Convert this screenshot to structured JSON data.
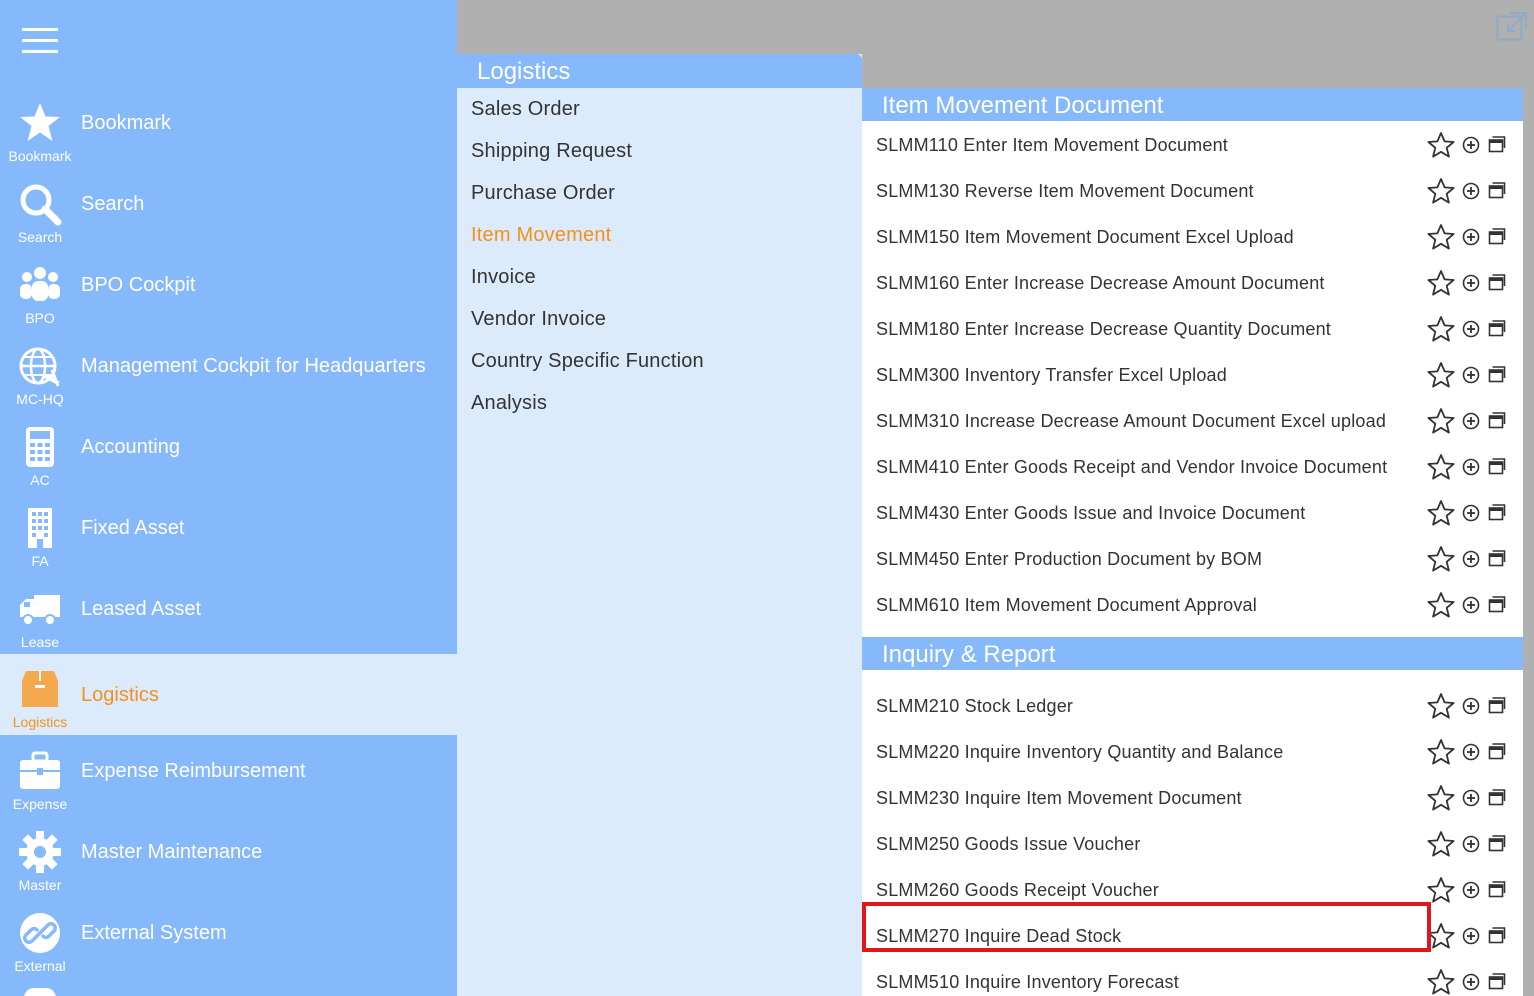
{
  "sidebar": {
    "items": [
      {
        "label": "Bookmark",
        "short": "Bookmark",
        "icon": "star-icon"
      },
      {
        "label": "Search",
        "short": "Search",
        "icon": "search-icon"
      },
      {
        "label": "BPO Cockpit",
        "short": "BPO",
        "icon": "users-icon"
      },
      {
        "label": "Management Cockpit for Headquarters",
        "short": "MC-HQ",
        "icon": "globe-plane-icon"
      },
      {
        "label": "Accounting",
        "short": "AC",
        "icon": "calculator-icon"
      },
      {
        "label": "Fixed Asset",
        "short": "FA",
        "icon": "building-icon"
      },
      {
        "label": "Leased Asset",
        "short": "Lease",
        "icon": "truck-icon"
      },
      {
        "label": "Logistics",
        "short": "Logistics",
        "icon": "box-icon",
        "active": true
      },
      {
        "label": "Expense Reimbursement",
        "short": "Expense",
        "icon": "briefcase-icon"
      },
      {
        "label": "Master Maintenance",
        "short": "Master",
        "icon": "gear-icon"
      },
      {
        "label": "External System",
        "short": "External",
        "icon": "link-icon"
      }
    ]
  },
  "mid": {
    "title": "Logistics",
    "items": [
      {
        "label": "Sales Order"
      },
      {
        "label": "Shipping Request"
      },
      {
        "label": "Purchase Order"
      },
      {
        "label": "Item Movement",
        "active": true
      },
      {
        "label": "Invoice"
      },
      {
        "label": "Vendor Invoice"
      },
      {
        "label": "Country Specific Function"
      },
      {
        "label": "Analysis"
      }
    ]
  },
  "right": {
    "sections": [
      {
        "title": "Item Movement Document",
        "rows": [
          "SLMM110 Enter Item Movement Document",
          "SLMM130 Reverse Item Movement Document",
          "SLMM150 Item Movement Document Excel Upload",
          "SLMM160 Enter Increase Decrease Amount Document",
          "SLMM180 Enter Increase Decrease Quantity Document",
          "SLMM300 Inventory Transfer Excel Upload",
          "SLMM310 Increase Decrease Amount Document Excel upload",
          "SLMM410 Enter Goods Receipt and Vendor Invoice Document",
          "SLMM430 Enter Goods Issue and Invoice Document",
          "SLMM450 Enter Production Document by BOM",
          "SLMM610 Item Movement Document Approval"
        ]
      },
      {
        "title": "Inquiry & Report",
        "rows": [
          "SLMM210 Stock Ledger",
          "SLMM220 Inquire Inventory Quantity and Balance",
          "SLMM230 Inquire Item Movement Document",
          "SLMM250 Goods Issue Voucher",
          "SLMM260 Goods Receipt Voucher",
          "SLMM270 Inquire Dead Stock",
          "SLMM510 Inquire Inventory Forecast"
        ]
      }
    ]
  },
  "colors": {
    "sidebar_bg": "#86b8fc",
    "panel_bg": "#dcebfc",
    "accent_orange": "#f5901c",
    "highlight_red": "#e0161c",
    "topbar_gray": "#b0b0b0"
  }
}
